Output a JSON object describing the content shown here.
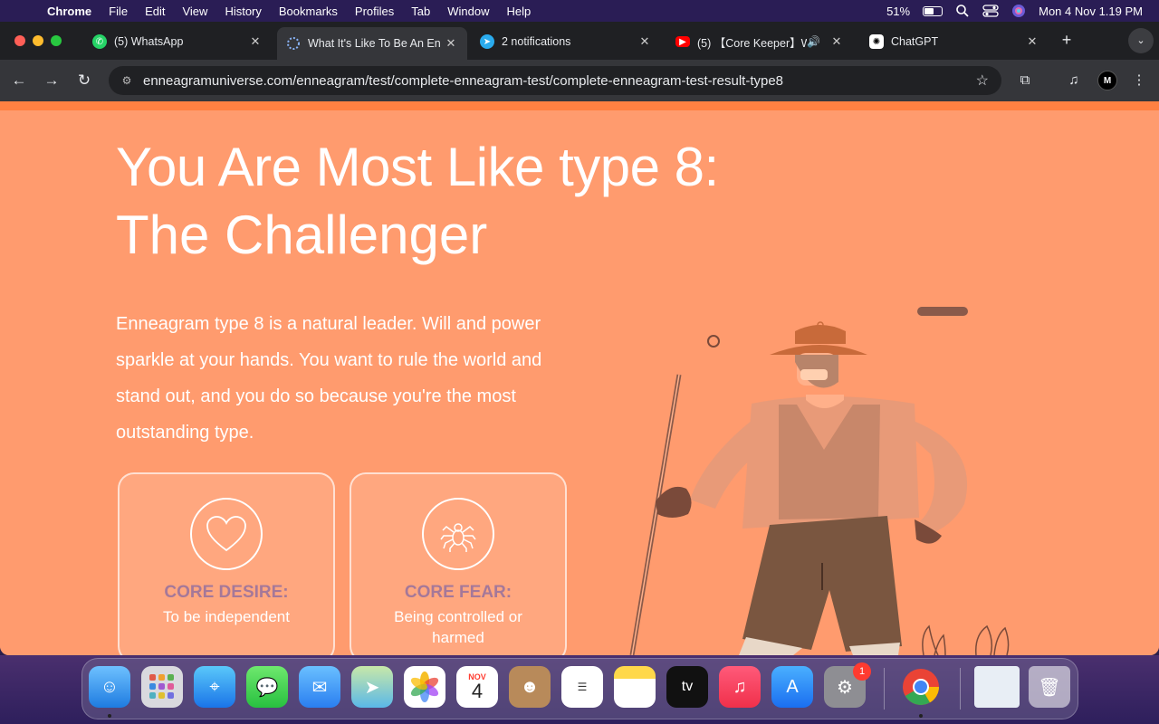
{
  "menubar": {
    "app": "Chrome",
    "items": [
      "File",
      "Edit",
      "View",
      "History",
      "Bookmarks",
      "Profiles",
      "Tab",
      "Window",
      "Help"
    ],
    "battery": "51%",
    "datetime": "Mon 4 Nov  1.19 PM"
  },
  "tabs": [
    {
      "title": "(5) WhatsApp",
      "icon": "whatsapp-icon",
      "color": "#25d366"
    },
    {
      "title": "What It's Like To Be An En",
      "icon": "loading-icon",
      "color": "#8ab4f8"
    },
    {
      "title": "2 notifications",
      "icon": "telegram-icon",
      "color": "#2aabee"
    },
    {
      "title": "(5) 【Core Keeper】W",
      "icon": "youtube-icon",
      "color": "#ff0000"
    },
    {
      "title": "ChatGPT",
      "icon": "chatgpt-icon",
      "color": "#ffffff"
    }
  ],
  "toolbar": {
    "url": "enneagramuniverse.com/enneagram/test/complete-enneagram-test/complete-enneagram-test-result-type8",
    "profile_initial": "M"
  },
  "page": {
    "heading_line1": "You Are Most Like type 8:",
    "heading_line2": "The Challenger",
    "description": "Enneagram type 8 is a natural leader. Will and power sparkle at your hands. You want to rule the world and stand out, and you do so because you're the most outstanding type.",
    "cards": [
      {
        "title": "CORE DESIRE:",
        "value": "To be independent",
        "icon": "heart-icon"
      },
      {
        "title": "CORE FEAR:",
        "value": "Being controlled or harmed",
        "icon": "spider-icon"
      }
    ]
  },
  "dock": {
    "items": [
      "Finder",
      "Launchpad",
      "Safari",
      "Messages",
      "Mail",
      "Maps",
      "Photos",
      "Calendar",
      "Contacts",
      "Reminders",
      "Notes",
      "TV",
      "Music",
      "App Store",
      "System Settings",
      "Chrome",
      "Downloads",
      "Trash"
    ],
    "calendar_month": "NOV",
    "calendar_day": "4",
    "settings_badge": "1"
  },
  "colors": {
    "page_bg": "#ff9b6e",
    "stripe": "#ff8142",
    "card_title": "#a57899"
  }
}
